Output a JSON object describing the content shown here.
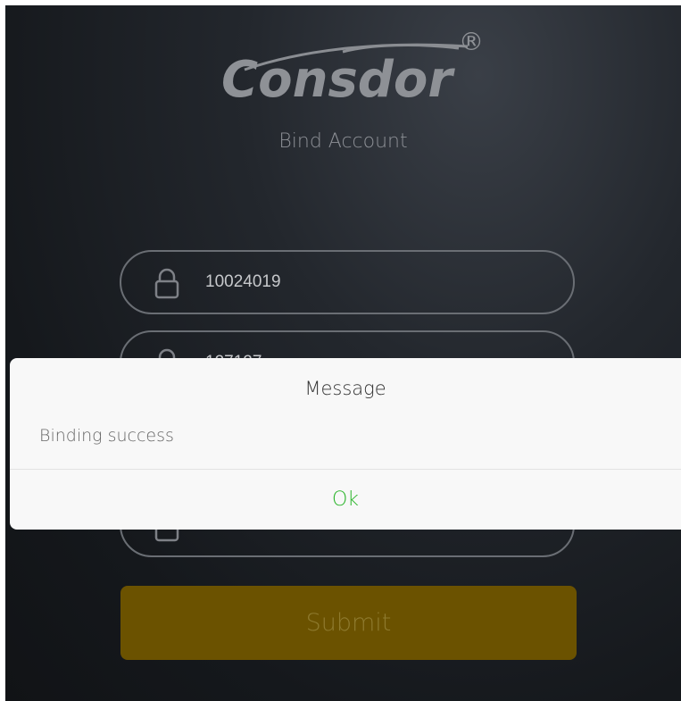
{
  "app": {
    "logo_text": "Consdor",
    "registered_mark": "®",
    "title": "Bind Account"
  },
  "form": {
    "fields": [
      {
        "icon": "lock-icon",
        "value": "10024019"
      },
      {
        "icon": "lock-icon",
        "value": "127127"
      },
      {
        "icon": "lock-icon",
        "value": ""
      }
    ],
    "submit_label": "Submit"
  },
  "dialog": {
    "title": "Message",
    "message": "Binding success",
    "ok_label": "Ok"
  },
  "colors": {
    "background": "#1c1f24",
    "submit": "#6b5200",
    "ok": "#2cb52c"
  }
}
